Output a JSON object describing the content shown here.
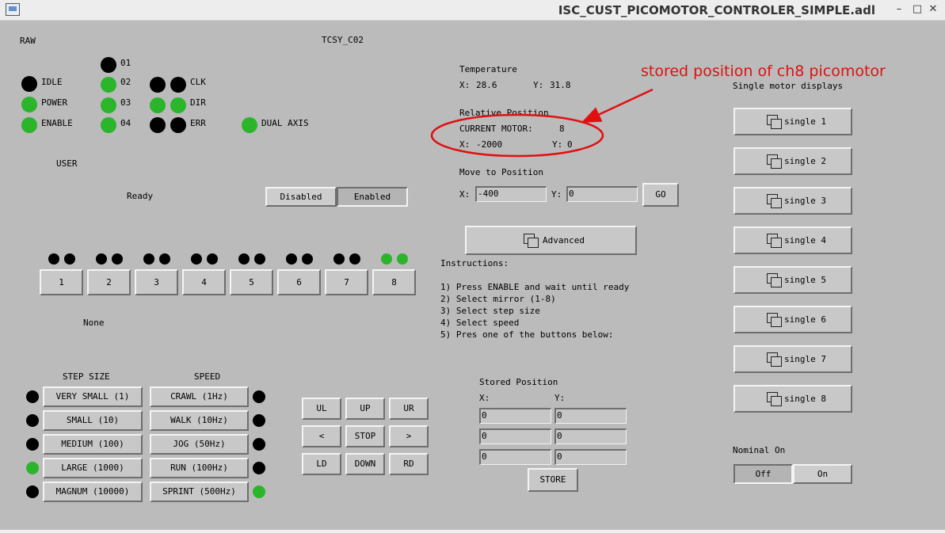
{
  "window": {
    "title": "ISC_CUST_PICOMOTOR_CONTROLER_SIMPLE.adl",
    "minimize": "–",
    "maximize": "□",
    "close": "✕"
  },
  "colors": {
    "on": "#2ab52a",
    "off": "#000000",
    "annotation": "#e01010"
  },
  "header": {
    "raw": "RAW",
    "device": "TCSY_C02"
  },
  "status": {
    "idle": "IDLE",
    "power": "POWER",
    "enable": "ENABLE",
    "ch01": "01",
    "ch02": "02",
    "ch03": "03",
    "ch04": "04",
    "clk": "CLK",
    "dir": "DIR",
    "err": "ERR",
    "dual_axis": "DUAL AXIS"
  },
  "user": {
    "label": "USER",
    "state": "Ready",
    "disabled": "Disabled",
    "enabled": "Enabled"
  },
  "mirrors": [
    "1",
    "2",
    "3",
    "4",
    "5",
    "6",
    "7",
    "8"
  ],
  "selected_mirror": "8",
  "mirror_state": "None",
  "step": {
    "title": "STEP SIZE",
    "options": [
      "VERY SMALL (1)",
      "SMALL (10)",
      "MEDIUM (100)",
      "LARGE (1000)",
      "MAGNUM (10000)"
    ],
    "selected": "LARGE (1000)"
  },
  "speed": {
    "title": "SPEED",
    "options": [
      "CRAWL (1Hz)",
      "WALK (10Hz)",
      "JOG (50Hz)",
      "RUN (100Hz)",
      "SPRINT (500Hz)"
    ],
    "selected": "SPRINT (500Hz)"
  },
  "jog": {
    "ul": "UL",
    "up": "UP",
    "ur": "UR",
    "left": "<",
    "stop": "STOP",
    "right": ">",
    "ld": "LD",
    "down": "DOWN",
    "rd": "RD"
  },
  "temperature": {
    "title": "Temperature",
    "x_label": "X:",
    "x": "28.6",
    "y_label": "Y:",
    "y": "31.8"
  },
  "relative": {
    "title": "Relative Position",
    "motor_label": "CURRENT MOTOR:",
    "motor": "8",
    "x_label": "X:",
    "x": "-2000",
    "y_label": "Y:",
    "y": "0"
  },
  "move": {
    "title": "Move to Position",
    "x_label": "X:",
    "x": "-400",
    "y_label": "Y:",
    "y": "0",
    "go": "GO"
  },
  "advanced": "Advanced",
  "instructions": {
    "title": "Instructions:",
    "lines": [
      "1) Press ENABLE and wait until ready",
      "2) Select mirror (1-8)",
      "3) Select step size",
      "4) Select speed",
      "5) Pres one of the buttons below:"
    ]
  },
  "stored": {
    "title": "Stored Position",
    "x_label": "X:",
    "y_label": "Y:",
    "x": [
      "0",
      "0",
      "0"
    ],
    "y": [
      "0",
      "0",
      "0"
    ],
    "store": "STORE"
  },
  "single": {
    "title": "Single motor displays",
    "buttons": [
      "single 1",
      "single 2",
      "single 3",
      "single 4",
      "single 5",
      "single 6",
      "single 7",
      "single 8"
    ]
  },
  "nominal": {
    "title": "Nominal On",
    "off": "Off",
    "on": "On"
  },
  "annotation": "stored position of ch8 picomotor"
}
